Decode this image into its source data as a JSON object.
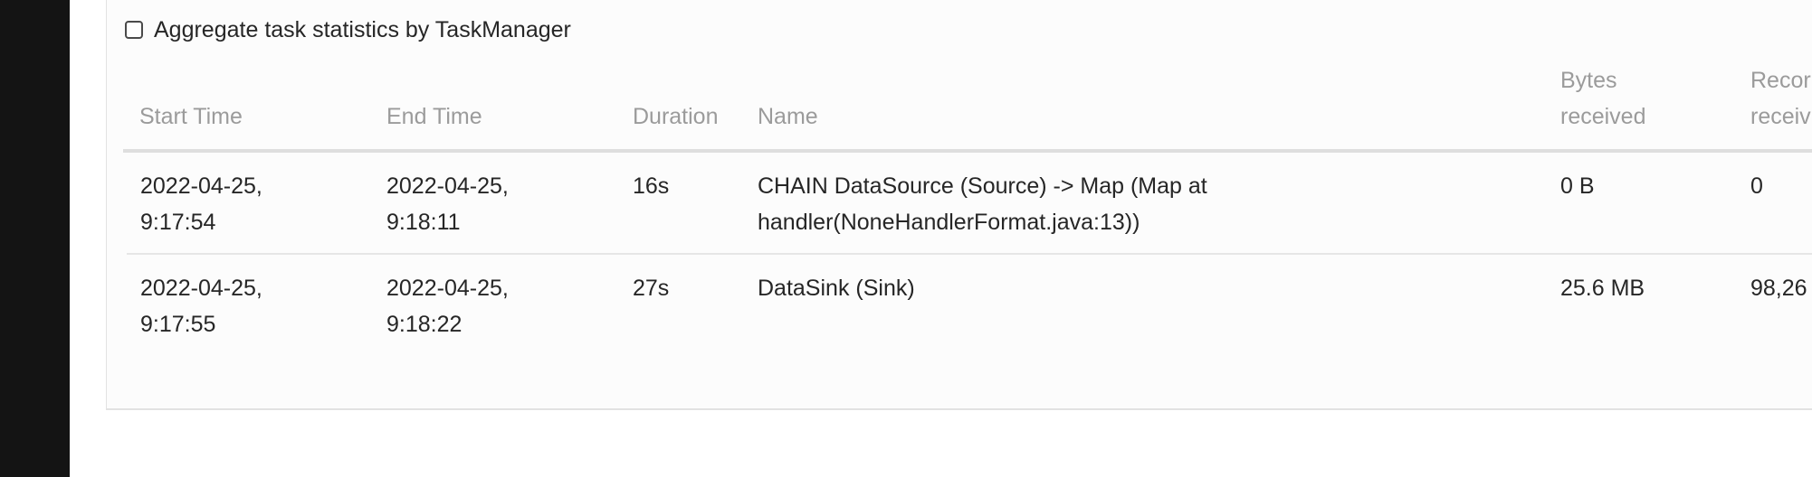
{
  "aggregate": {
    "label": "Aggregate task statistics by TaskManager",
    "checked": false
  },
  "table": {
    "headers": {
      "start_time": "Start Time",
      "end_time": "End Time",
      "duration": "Duration",
      "name": "Name",
      "bytes_received_1": "Bytes",
      "bytes_received_2": "received",
      "records_received_1": "Recor",
      "records_received_2": "receiv"
    },
    "rows": [
      {
        "start_date": "2022-04-25,",
        "start_clock": "9:17:54",
        "end_date": "2022-04-25,",
        "end_clock": "9:18:11",
        "duration": "16s",
        "name_line1": "CHAIN DataSource (Source) -> Map (Map at",
        "name_line2": "handler(NoneHandlerFormat.java:13))",
        "bytes_received": "0 B",
        "records_received": "0"
      },
      {
        "start_date": "2022-04-25,",
        "start_clock": "9:17:55",
        "end_date": "2022-04-25,",
        "end_clock": "9:18:22",
        "duration": "27s",
        "name_line1": "DataSink (Sink)",
        "name_line2": "",
        "bytes_received": "25.6 MB",
        "records_received": "98,26"
      }
    ]
  }
}
